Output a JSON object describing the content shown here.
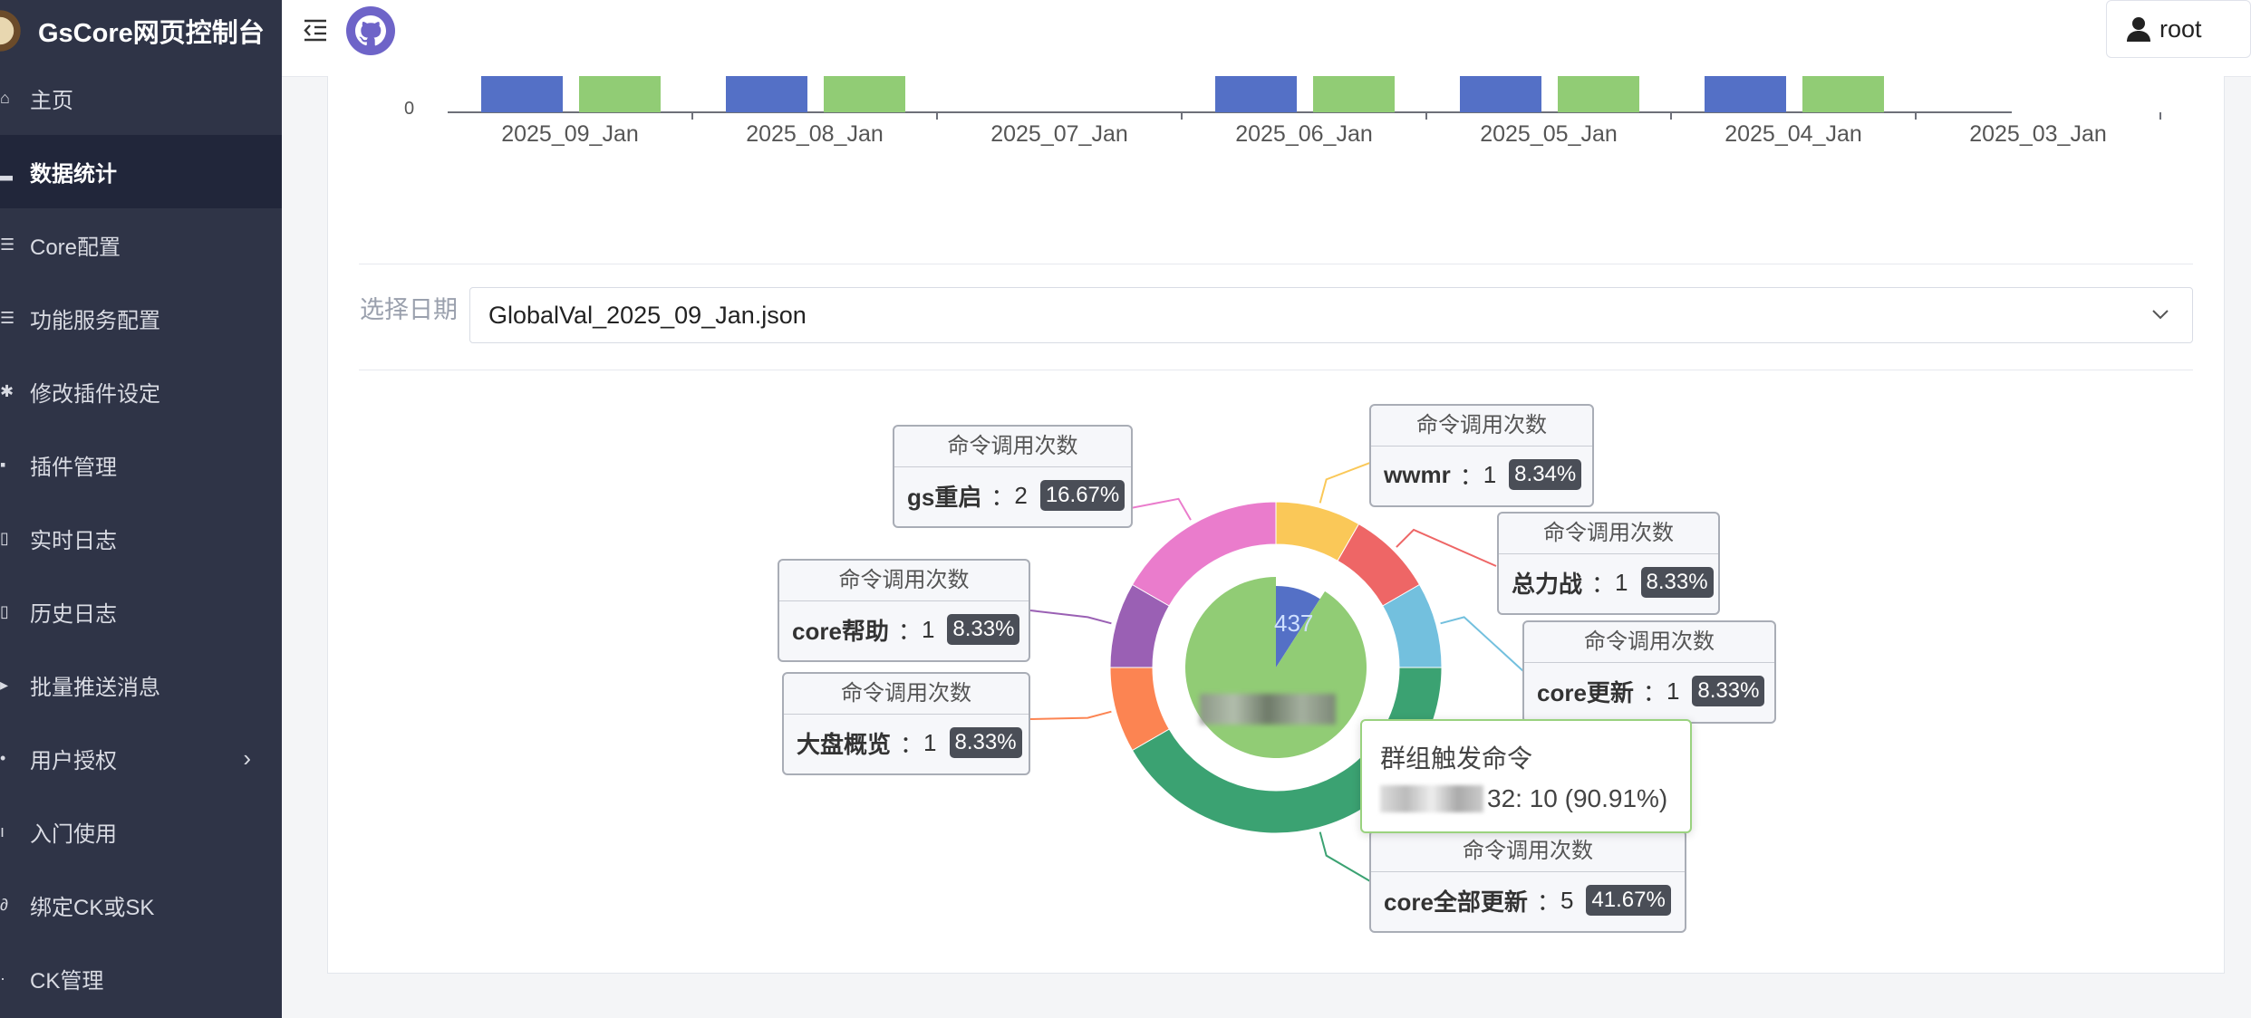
{
  "brand": {
    "title": "GsCore网页控制台"
  },
  "sidebar": {
    "items": [
      {
        "label": "主页"
      },
      {
        "label": "数据统计"
      },
      {
        "label": "Core配置"
      },
      {
        "label": "功能服务配置"
      },
      {
        "label": "修改插件设定"
      },
      {
        "label": "插件管理"
      },
      {
        "label": "实时日志"
      },
      {
        "label": "历史日志"
      },
      {
        "label": "批量推送消息"
      },
      {
        "label": "用户授权"
      },
      {
        "label": "入门使用"
      },
      {
        "label": "绑定CK或SK"
      },
      {
        "label": "CK管理"
      }
    ]
  },
  "header": {
    "user": "root"
  },
  "filter": {
    "label": "选择日期",
    "selected": "GlobalVal_2025_09_Jan.json"
  },
  "chart_data": [
    {
      "type": "bar",
      "categories": [
        "2025_09_Jan",
        "2025_08_Jan",
        "2025_07_Jan",
        "2025_06_Jan",
        "2025_05_Jan",
        "2025_04_Jan",
        "2025_03_Jan"
      ],
      "colors": [
        "#5470c6",
        "#91cc75"
      ],
      "tick_label_partial": "0"
    },
    {
      "type": "pie",
      "title": "命令调用次数",
      "slices": [
        {
          "name": "wwmr",
          "value": 1,
          "percent": "8.34%",
          "color": "#fac858"
        },
        {
          "name": "总力战",
          "value": 1,
          "percent": "8.33%",
          "color": "#ee6666"
        },
        {
          "name": "core更新",
          "value": 1,
          "percent": "8.33%",
          "color": "#73c0de"
        },
        {
          "name": "core全部更新",
          "value": 5,
          "percent": "41.67%",
          "color": "#3ba272"
        },
        {
          "name": "大盘概览",
          "value": 1,
          "percent": "8.33%",
          "color": "#fc8452"
        },
        {
          "name": "core帮助",
          "value": 1,
          "percent": "8.33%",
          "color": "#9a60b4"
        },
        {
          "name": "gs重启",
          "value": 2,
          "percent": "16.67%",
          "color": "#ea7ccc"
        }
      ]
    },
    {
      "type": "pie",
      "title": "群组触发命令",
      "slices": [
        {
          "name": "…437",
          "value": 1,
          "color": "#5470c6"
        },
        {
          "name": "…32",
          "value": 10,
          "percent": "90.91%",
          "color": "#91cc75"
        }
      ]
    }
  ],
  "labels": {
    "pie_title": "命令调用次数",
    "sep": "："
  },
  "tooltip": {
    "title": "群组触发命令",
    "value_text": "32: 10 (90.91%)"
  },
  "inner_label": "437"
}
